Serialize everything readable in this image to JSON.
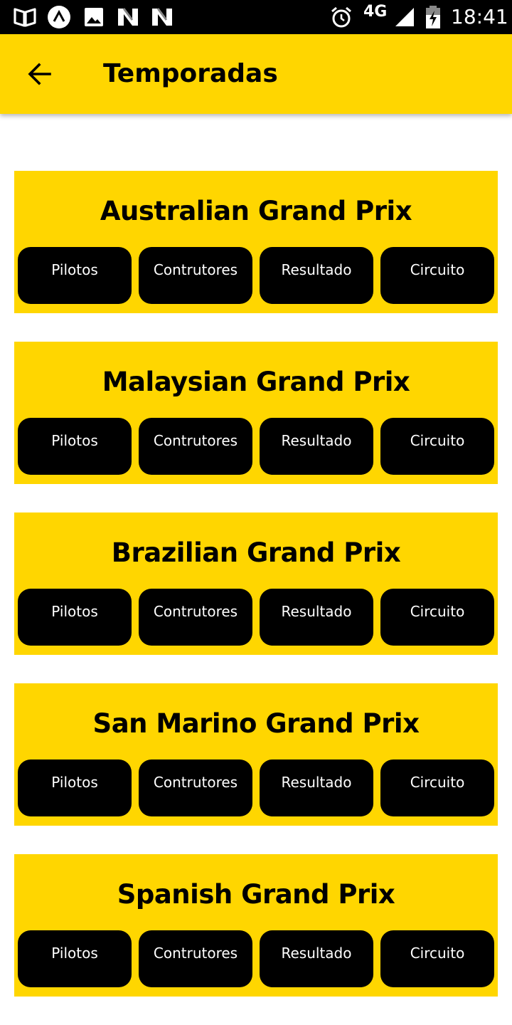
{
  "status_bar": {
    "network": "4G",
    "time": "18:41",
    "icons": [
      "book-icon",
      "expo-icon",
      "image-icon",
      "n-icon",
      "n-icon",
      "alarm-icon",
      "signal-icon",
      "battery-charging-icon"
    ]
  },
  "app_bar": {
    "back_icon": "arrow-back-icon",
    "title": "Temporadas",
    "color": "#FFD600"
  },
  "races": [
    {
      "name": "Australian Grand Prix",
      "buttons": {
        "pilotos": "Pilotos",
        "construtores": "Contrutores",
        "resultado": "Resultado",
        "circuito": "Circuito"
      }
    },
    {
      "name": "Malaysian Grand Prix",
      "buttons": {
        "pilotos": "Pilotos",
        "construtores": "Contrutores",
        "resultado": "Resultado",
        "circuito": "Circuito"
      }
    },
    {
      "name": "Brazilian Grand Prix",
      "buttons": {
        "pilotos": "Pilotos",
        "construtores": "Contrutores",
        "resultado": "Resultado",
        "circuito": "Circuito"
      }
    },
    {
      "name": "San Marino Grand Prix",
      "buttons": {
        "pilotos": "Pilotos",
        "construtores": "Contrutores",
        "resultado": "Resultado",
        "circuito": "Circuito"
      }
    },
    {
      "name": "Spanish Grand Prix",
      "buttons": {
        "pilotos": "Pilotos",
        "construtores": "Contrutores",
        "resultado": "Resultado",
        "circuito": "Circuito"
      }
    }
  ]
}
